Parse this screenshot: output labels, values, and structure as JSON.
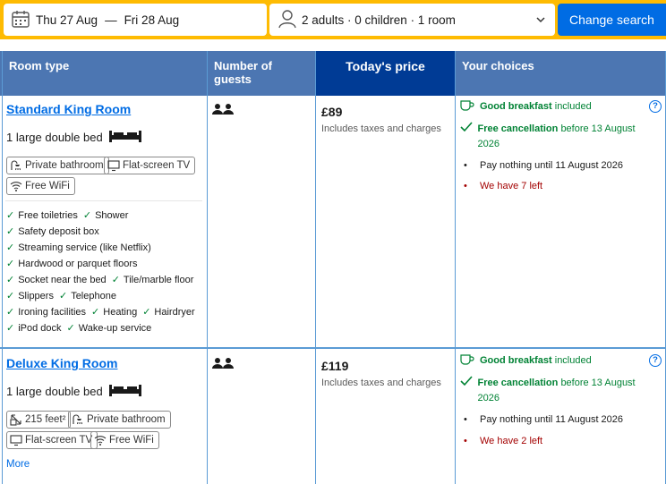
{
  "search": {
    "dates": {
      "checkin": "Thu 27 Aug",
      "separator": "—",
      "checkout": "Fri 28 Aug"
    },
    "guests_summary": "2 adults · 0 children · 1 room",
    "button": "Change search"
  },
  "table": {
    "headers": {
      "room_type": "Room type",
      "guests": "Number of guests",
      "price": "Today's price",
      "choices": "Your choices"
    }
  },
  "rooms": [
    {
      "name": "Standard King Room",
      "bed": "1 large double bed",
      "facilities": [
        "Private bathroom",
        "Flat-screen TV",
        "Free WiFi"
      ],
      "amenity_rows": [
        [
          "Free toiletries",
          "Shower"
        ],
        [
          "Safety deposit box"
        ],
        [
          "Streaming service (like Netflix)"
        ],
        [
          "Hardwood or parquet floors"
        ],
        [
          "Socket near the bed",
          "Tile/marble floor"
        ],
        [
          "Slippers",
          "Telephone"
        ],
        [
          "Ironing facilities",
          "Heating",
          "Hairdryer"
        ],
        [
          "iPod dock",
          "Wake-up service"
        ]
      ],
      "price": "£89",
      "taxes": "Includes taxes and charges",
      "breakfast": {
        "bold": "Good breakfast",
        "rest": "included"
      },
      "cancellation": {
        "bold": "Free cancellation",
        "rest": "before 13 August 2026"
      },
      "pay": "Pay nothing until 11 August 2026",
      "left": "We have 7 left"
    },
    {
      "name": "Deluxe King Room",
      "bed": "1 large double bed",
      "facilities": [
        "215 feet²",
        "Private bathroom",
        "Flat-screen TV",
        "Free WiFi"
      ],
      "more": "More",
      "price": "£119",
      "taxes": "Includes taxes and charges",
      "breakfast": {
        "bold": "Good breakfast",
        "rest": "included"
      },
      "cancellation": {
        "bold": "Free cancellation",
        "rest": "before 13 August 2026"
      },
      "pay": "Pay nothing until 11 August 2026",
      "left": "We have 2 left"
    }
  ],
  "colors": {
    "search_bg": "#febb02",
    "primary": "#006ce4",
    "header": "#4c76b2",
    "header_dark": "#003b95",
    "green": "#008234",
    "red": "#a30000"
  }
}
